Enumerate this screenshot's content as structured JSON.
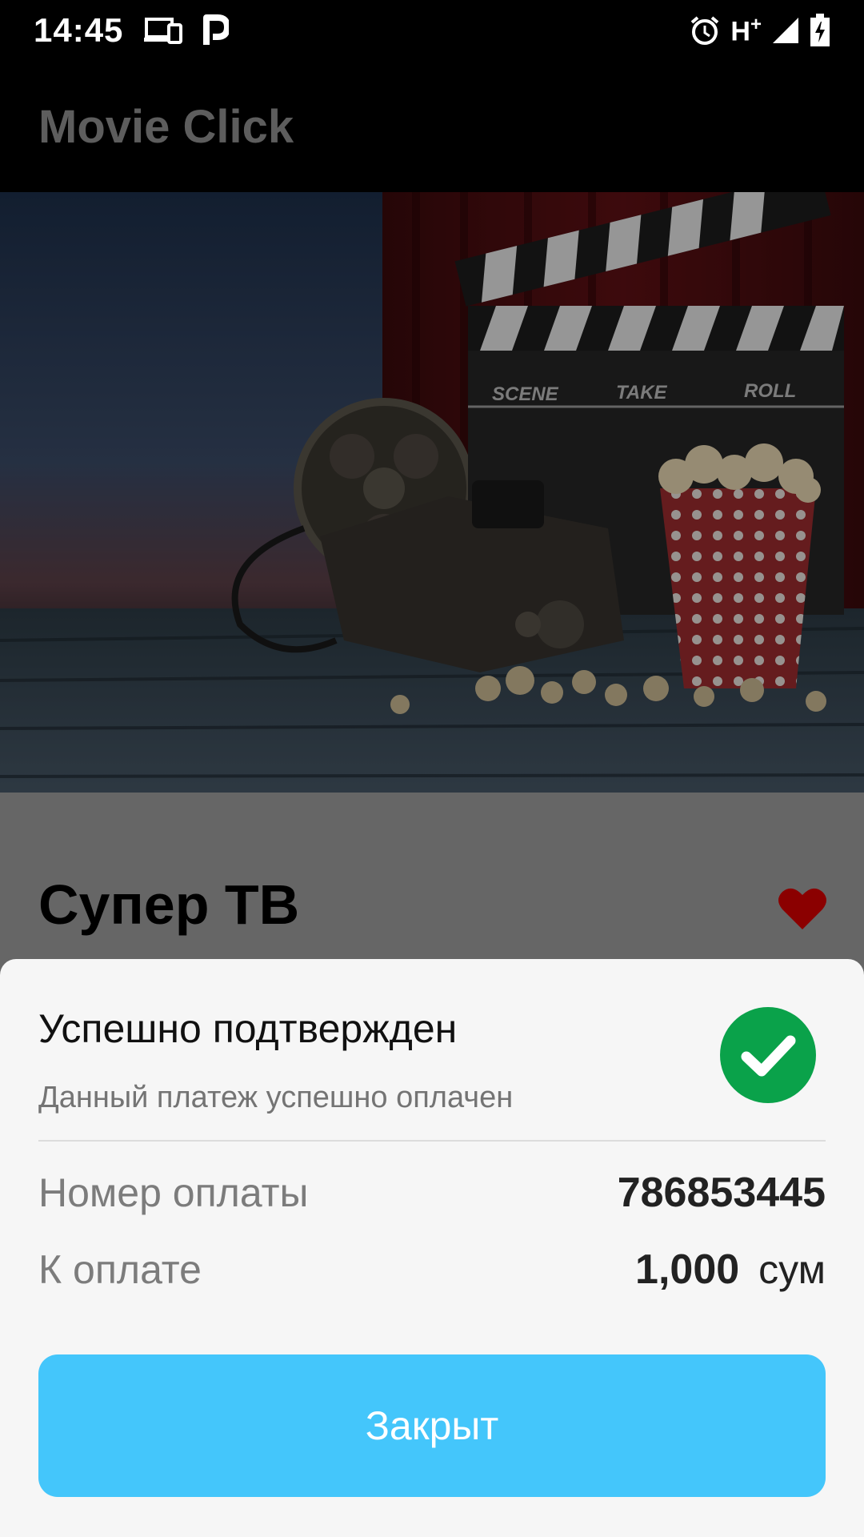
{
  "status_bar": {
    "time": "14:45",
    "network_label": "H",
    "network_suffix": "+",
    "icons": [
      "devices-icon",
      "parking-icon",
      "alarm-icon",
      "signal-icon",
      "battery-icon"
    ]
  },
  "app_bar": {
    "title": "Movie Click"
  },
  "movie": {
    "title": "Супер ТВ",
    "clapper_labels": [
      "SCENE",
      "TAKE",
      "ROLL"
    ],
    "favorite_color": "#8b0000"
  },
  "payment_sheet": {
    "title": "Успешно подтвержден",
    "subtitle": "Данный платеж успешно оплачен",
    "success_color": "#0aa24a",
    "rows": [
      {
        "label": "Номер оплаты",
        "value": "786853445"
      },
      {
        "label": "К оплате",
        "value": "1,000",
        "currency": "сум"
      }
    ],
    "close_label": "Закрыт",
    "button_color": "#44c6fb"
  }
}
